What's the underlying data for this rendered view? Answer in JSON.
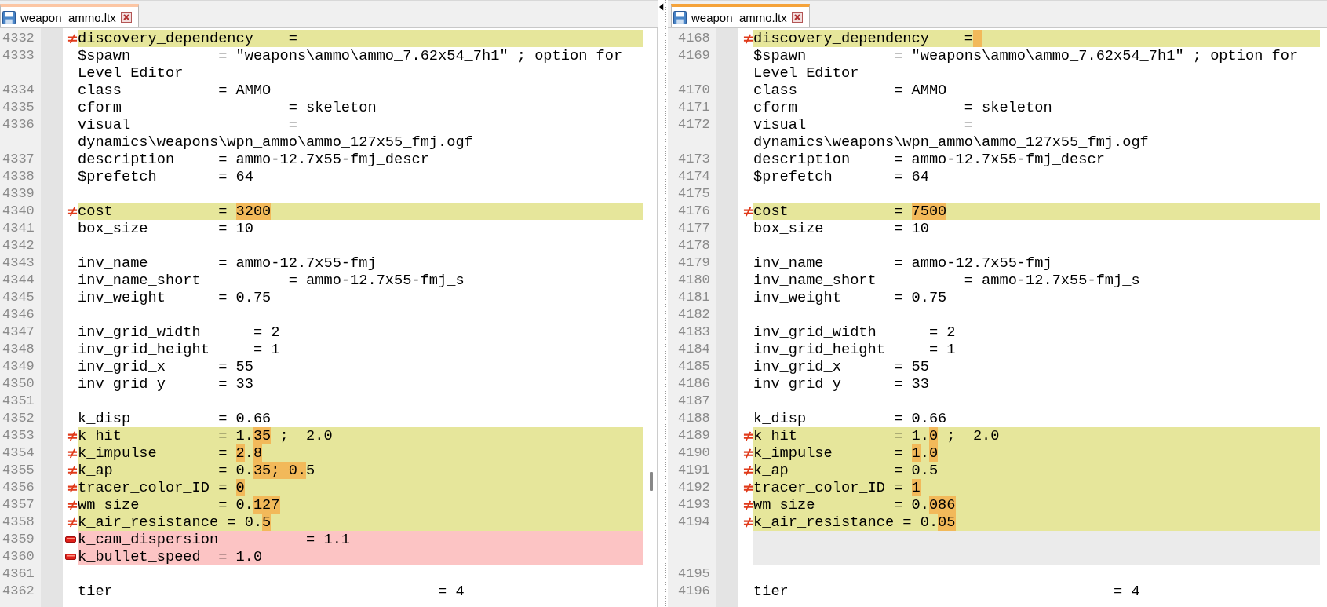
{
  "panes": [
    {
      "tab": {
        "label": "weapon_ammo.ltx",
        "selected": false
      },
      "lines": [
        {
          "number": "4332",
          "kind": "changed",
          "segments": [
            {
              "text": "discovery_dependency    =",
              "hl": false
            }
          ]
        },
        {
          "number": "4333",
          "kind": "same",
          "segments": [
            {
              "text": "$spawn          = \"weapons\\ammo\\ammo_7.62x54_7h1\" ; option for",
              "hl": false
            }
          ]
        },
        {
          "kind": "same",
          "segments": [
            {
              "text": "Level Editor",
              "hl": false
            }
          ]
        },
        {
          "number": "4334",
          "kind": "same",
          "segments": [
            {
              "text": "class           = AMMO",
              "hl": false
            }
          ]
        },
        {
          "number": "4335",
          "kind": "same",
          "segments": [
            {
              "text": "cform                   = skeleton",
              "hl": false
            }
          ]
        },
        {
          "number": "4336",
          "kind": "same",
          "segments": [
            {
              "text": "visual                  =",
              "hl": false
            }
          ]
        },
        {
          "kind": "same",
          "segments": [
            {
              "text": "dynamics\\weapons\\wpn_ammo\\ammo_127x55_fmj.ogf",
              "hl": false
            }
          ]
        },
        {
          "number": "4337",
          "kind": "same",
          "segments": [
            {
              "text": "description     = ammo-12.7x55-fmj_descr",
              "hl": false
            }
          ]
        },
        {
          "number": "4338",
          "kind": "same",
          "segments": [
            {
              "text": "$prefetch       = 64",
              "hl": false
            }
          ]
        },
        {
          "number": "4339",
          "kind": "same"
        },
        {
          "number": "4340",
          "kind": "changed",
          "segments": [
            {
              "text": "cost            = ",
              "hl": false
            },
            {
              "text": "3200",
              "hl": true
            }
          ]
        },
        {
          "number": "4341",
          "kind": "same",
          "segments": [
            {
              "text": "box_size        = 10",
              "hl": false
            }
          ]
        },
        {
          "number": "4342",
          "kind": "same"
        },
        {
          "number": "4343",
          "kind": "same",
          "segments": [
            {
              "text": "inv_name        = ammo-12.7x55-fmj",
              "hl": false
            }
          ]
        },
        {
          "number": "4344",
          "kind": "same",
          "segments": [
            {
              "text": "inv_name_short          = ammo-12.7x55-fmj_s",
              "hl": false
            }
          ]
        },
        {
          "number": "4345",
          "kind": "same",
          "segments": [
            {
              "text": "inv_weight      = 0.75",
              "hl": false
            }
          ]
        },
        {
          "number": "4346",
          "kind": "same"
        },
        {
          "number": "4347",
          "kind": "same",
          "segments": [
            {
              "text": "inv_grid_width      = 2",
              "hl": false
            }
          ]
        },
        {
          "number": "4348",
          "kind": "same",
          "segments": [
            {
              "text": "inv_grid_height     = 1",
              "hl": false
            }
          ]
        },
        {
          "number": "4349",
          "kind": "same",
          "segments": [
            {
              "text": "inv_grid_x      = 55",
              "hl": false
            }
          ]
        },
        {
          "number": "4350",
          "kind": "same",
          "segments": [
            {
              "text": "inv_grid_y      = 33",
              "hl": false
            }
          ]
        },
        {
          "number": "4351",
          "kind": "same"
        },
        {
          "number": "4352",
          "kind": "same",
          "segments": [
            {
              "text": "k_disp          = 0.66",
              "hl": false
            }
          ]
        },
        {
          "number": "4353",
          "kind": "changed",
          "segments": [
            {
              "text": "k_hit           = 1.",
              "hl": false
            },
            {
              "text": "35",
              "hl": true
            },
            {
              "text": " ;  2.0",
              "hl": false
            }
          ]
        },
        {
          "number": "4354",
          "kind": "changed",
          "segments": [
            {
              "text": "k_impulse       = ",
              "hl": false
            },
            {
              "text": "2",
              "hl": true
            },
            {
              "text": ".",
              "hl": false
            },
            {
              "text": "8",
              "hl": true
            }
          ]
        },
        {
          "number": "4355",
          "kind": "changed",
          "segments": [
            {
              "text": "k_ap            = 0.",
              "hl": false
            },
            {
              "text": "35; 0.",
              "hl": true
            },
            {
              "text": "5",
              "hl": false
            }
          ]
        },
        {
          "number": "4356",
          "kind": "changed",
          "segments": [
            {
              "text": "tracer_color_ID = ",
              "hl": false
            },
            {
              "text": "0",
              "hl": true
            }
          ]
        },
        {
          "number": "4357",
          "kind": "changed",
          "segments": [
            {
              "text": "wm_size         = 0.",
              "hl": false
            },
            {
              "text": "127",
              "hl": true
            }
          ]
        },
        {
          "number": "4358",
          "kind": "changed",
          "segments": [
            {
              "text": "k_air_resistance = 0.",
              "hl": false
            },
            {
              "text": "5",
              "hl": true
            }
          ]
        },
        {
          "number": "4359",
          "kind": "removed",
          "segments": [
            {
              "text": "k_cam_dispersion          = 1.1",
              "hl": false
            }
          ]
        },
        {
          "number": "4360",
          "kind": "removed",
          "segments": [
            {
              "text": "k_bullet_speed  = 1.0",
              "hl": false
            }
          ]
        },
        {
          "number": "4361",
          "kind": "same"
        },
        {
          "number": "4362",
          "kind": "same",
          "segments": [
            {
              "text": "tier                                     = 4",
              "hl": false
            }
          ]
        }
      ]
    },
    {
      "tab": {
        "label": "weapon_ammo.ltx",
        "selected": true
      },
      "lines": [
        {
          "number": "4168",
          "kind": "changed",
          "trailing_highlight": true,
          "segments": [
            {
              "text": "discovery_dependency    =",
              "hl": false
            }
          ]
        },
        {
          "number": "4169",
          "kind": "same",
          "segments": [
            {
              "text": "$spawn          = \"weapons\\ammo\\ammo_7.62x54_7h1\" ; option for",
              "hl": false
            }
          ]
        },
        {
          "kind": "same",
          "segments": [
            {
              "text": "Level Editor",
              "hl": false
            }
          ]
        },
        {
          "number": "4170",
          "kind": "same",
          "segments": [
            {
              "text": "class           = AMMO",
              "hl": false
            }
          ]
        },
        {
          "number": "4171",
          "kind": "same",
          "segments": [
            {
              "text": "cform                   = skeleton",
              "hl": false
            }
          ]
        },
        {
          "number": "4172",
          "kind": "same",
          "segments": [
            {
              "text": "visual                  =",
              "hl": false
            }
          ]
        },
        {
          "kind": "same",
          "segments": [
            {
              "text": "dynamics\\weapons\\wpn_ammo\\ammo_127x55_fmj.ogf",
              "hl": false
            }
          ]
        },
        {
          "number": "4173",
          "kind": "same",
          "segments": [
            {
              "text": "description     = ammo-12.7x55-fmj_descr",
              "hl": false
            }
          ]
        },
        {
          "number": "4174",
          "kind": "same",
          "segments": [
            {
              "text": "$prefetch       = 64",
              "hl": false
            }
          ]
        },
        {
          "number": "4175",
          "kind": "same"
        },
        {
          "number": "4176",
          "kind": "changed",
          "segments": [
            {
              "text": "cost            = ",
              "hl": false
            },
            {
              "text": "7500",
              "hl": true
            }
          ]
        },
        {
          "number": "4177",
          "kind": "same",
          "segments": [
            {
              "text": "box_size        = 10",
              "hl": false
            }
          ]
        },
        {
          "number": "4178",
          "kind": "same"
        },
        {
          "number": "4179",
          "kind": "same",
          "segments": [
            {
              "text": "inv_name        = ammo-12.7x55-fmj",
              "hl": false
            }
          ]
        },
        {
          "number": "4180",
          "kind": "same",
          "segments": [
            {
              "text": "inv_name_short          = ammo-12.7x55-fmj_s",
              "hl": false
            }
          ]
        },
        {
          "number": "4181",
          "kind": "same",
          "segments": [
            {
              "text": "inv_weight      = 0.75",
              "hl": false
            }
          ]
        },
        {
          "number": "4182",
          "kind": "same"
        },
        {
          "number": "4183",
          "kind": "same",
          "segments": [
            {
              "text": "inv_grid_width      = 2",
              "hl": false
            }
          ]
        },
        {
          "number": "4184",
          "kind": "same",
          "segments": [
            {
              "text": "inv_grid_height     = 1",
              "hl": false
            }
          ]
        },
        {
          "number": "4185",
          "kind": "same",
          "segments": [
            {
              "text": "inv_grid_x      = 55",
              "hl": false
            }
          ]
        },
        {
          "number": "4186",
          "kind": "same",
          "segments": [
            {
              "text": "inv_grid_y      = 33",
              "hl": false
            }
          ]
        },
        {
          "number": "4187",
          "kind": "same"
        },
        {
          "number": "4188",
          "kind": "same",
          "segments": [
            {
              "text": "k_disp          = 0.66",
              "hl": false
            }
          ]
        },
        {
          "number": "4189",
          "kind": "changed",
          "segments": [
            {
              "text": "k_hit           = 1.",
              "hl": false
            },
            {
              "text": "0",
              "hl": true
            },
            {
              "text": " ;  2.0",
              "hl": false
            }
          ]
        },
        {
          "number": "4190",
          "kind": "changed",
          "segments": [
            {
              "text": "k_impulse       = ",
              "hl": false
            },
            {
              "text": "1",
              "hl": true
            },
            {
              "text": ".",
              "hl": false
            },
            {
              "text": "0",
              "hl": true
            }
          ]
        },
        {
          "number": "4191",
          "kind": "changed",
          "segments": [
            {
              "text": "k_ap            = 0.5",
              "hl": false
            }
          ]
        },
        {
          "number": "4192",
          "kind": "changed",
          "segments": [
            {
              "text": "tracer_color_ID = ",
              "hl": false
            },
            {
              "text": "1",
              "hl": true
            }
          ]
        },
        {
          "number": "4193",
          "kind": "changed",
          "segments": [
            {
              "text": "wm_size         = 0.",
              "hl": false
            },
            {
              "text": "086",
              "hl": true
            }
          ]
        },
        {
          "number": "4194",
          "kind": "changed",
          "segments": [
            {
              "text": "k_air_resistance = 0.",
              "hl": false
            },
            {
              "text": "05",
              "hl": true
            }
          ]
        },
        {
          "kind": "filler"
        },
        {
          "kind": "filler"
        },
        {
          "number": "4195",
          "kind": "same"
        },
        {
          "number": "4196",
          "kind": "same",
          "segments": [
            {
              "text": "tier                                     = 4",
              "hl": false
            }
          ]
        }
      ]
    }
  ]
}
